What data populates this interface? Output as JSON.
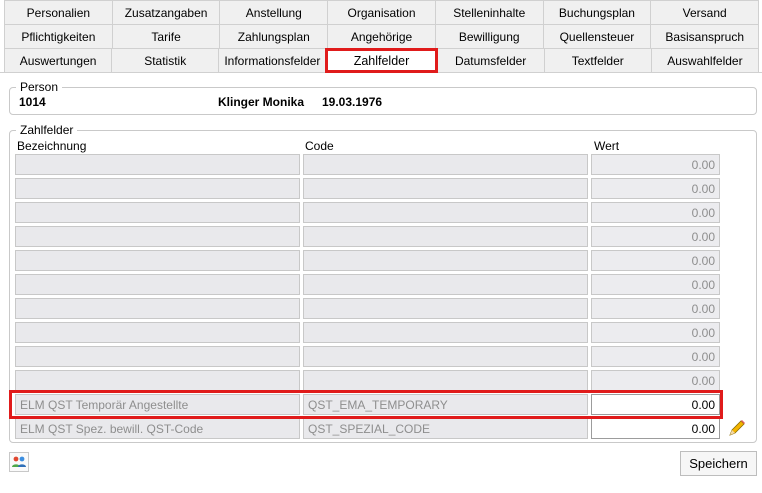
{
  "tabs": {
    "row1": [
      "Personalien",
      "Zusatzangaben",
      "Anstellung",
      "Organisation",
      "Stelleninhalte",
      "Buchungsplan",
      "Versand"
    ],
    "row2": [
      "Pflichtigkeiten",
      "Tarife",
      "Zahlungsplan",
      "Angehörige",
      "Bewilligung",
      "Quellensteuer",
      "Basisanspruch"
    ],
    "row3": [
      "Auswertungen",
      "Statistik",
      "Informationsfelder",
      "Zahlfelder",
      "Datumsfelder",
      "Textfelder",
      "Auswahlfelder"
    ],
    "active": "Zahlfelder"
  },
  "person": {
    "legend": "Person",
    "number": "1014",
    "name": "Klinger Monika",
    "birthdate": "19.03.1976"
  },
  "zahlfelder": {
    "legend": "Zahlfelder",
    "col_bezeichnung": "Bezeichnung",
    "col_code": "Code",
    "col_wert": "Wert",
    "rows": [
      {
        "bezeichnung": "",
        "code": "",
        "wert": "0.00"
      },
      {
        "bezeichnung": "",
        "code": "",
        "wert": "0.00"
      },
      {
        "bezeichnung": "",
        "code": "",
        "wert": "0.00"
      },
      {
        "bezeichnung": "",
        "code": "",
        "wert": "0.00"
      },
      {
        "bezeichnung": "",
        "code": "",
        "wert": "0.00"
      },
      {
        "bezeichnung": "",
        "code": "",
        "wert": "0.00"
      },
      {
        "bezeichnung": "",
        "code": "",
        "wert": "0.00"
      },
      {
        "bezeichnung": "",
        "code": "",
        "wert": "0.00"
      },
      {
        "bezeichnung": "",
        "code": "",
        "wert": "0.00"
      },
      {
        "bezeichnung": "",
        "code": "",
        "wert": "0.00"
      },
      {
        "bezeichnung": "ELM QST Temporär Angestellte",
        "code": "QST_EMA_TEMPORARY",
        "wert": "0.00"
      },
      {
        "bezeichnung": "ELM QST Spez. bewill. QST-Code",
        "code": "QST_SPEZIAL_CODE",
        "wert": "0.00"
      }
    ]
  },
  "footer": {
    "save_label": "Speichern"
  },
  "icons": {
    "pencil": "pencil-icon",
    "users": "users-icon"
  },
  "colors": {
    "highlight": "#e01b1b",
    "readonly_cell": "#e9e9ec"
  }
}
